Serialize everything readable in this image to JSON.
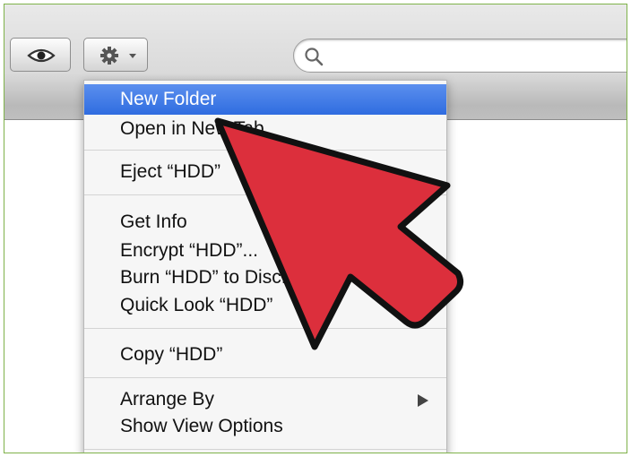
{
  "toolbar": {
    "eye_icon": "eye-icon",
    "gear_icon": "gear-icon",
    "dropdown_icon": "chevron-down-icon",
    "search_icon": "search-icon",
    "search_value": ""
  },
  "menu": {
    "new_folder": "New Folder",
    "open_in_new_tab": "Open in New Tab",
    "eject": "Eject “HDD”",
    "get_info": "Get Info",
    "encrypt": "Encrypt “HDD”...",
    "burn": "Burn “HDD” to Disc...",
    "quick_look": "Quick Look “HDD”",
    "copy": "Copy “HDD”",
    "arrange_by": "Arrange By",
    "show_view_options": "Show View Options"
  },
  "annotation": {
    "arrow_color": "#dc2f3c",
    "outline_color": "#111111"
  },
  "colors": {
    "highlight": "#3d7ae6",
    "frame_border": "#7fb24a"
  }
}
